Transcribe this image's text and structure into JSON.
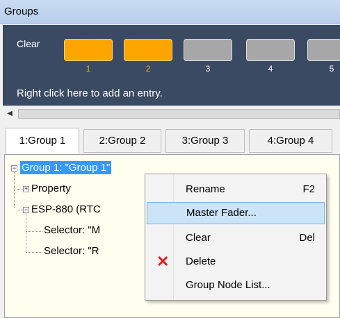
{
  "window": {
    "title": "Groups"
  },
  "panel": {
    "clear_label": "Clear",
    "tiles": [
      {
        "number": "1",
        "active": true
      },
      {
        "number": "2",
        "active": true
      },
      {
        "number": "3",
        "active": false
      },
      {
        "number": "4",
        "active": false
      },
      {
        "number": "5",
        "active": false
      }
    ],
    "hint": "Right click here to add an entry."
  },
  "tabs": [
    "1:Group 1",
    "2:Group 2",
    "3:Group 3",
    "4:Group 4"
  ],
  "tree": {
    "root": "Group 1: \"Group 1\"",
    "property": "Property",
    "device": "ESP-880 (RTC",
    "selector1": "Selector: \"M",
    "selector2": "Selector: \"R"
  },
  "context_menu": {
    "items": [
      {
        "label": "Rename",
        "shortcut": "F2"
      },
      {
        "label": "Master Fader...",
        "shortcut": ""
      },
      {
        "label": "Clear",
        "shortcut": "Del"
      },
      {
        "label": "Delete",
        "shortcut": "",
        "icon": "delete-x-icon"
      },
      {
        "label": "Group Node List...",
        "shortcut": ""
      }
    ]
  },
  "colors": {
    "active_tile": "#ffa500",
    "selection": "#3399ff",
    "panel_bg": "#3a4a63",
    "delete_icon": "#e0201a"
  }
}
